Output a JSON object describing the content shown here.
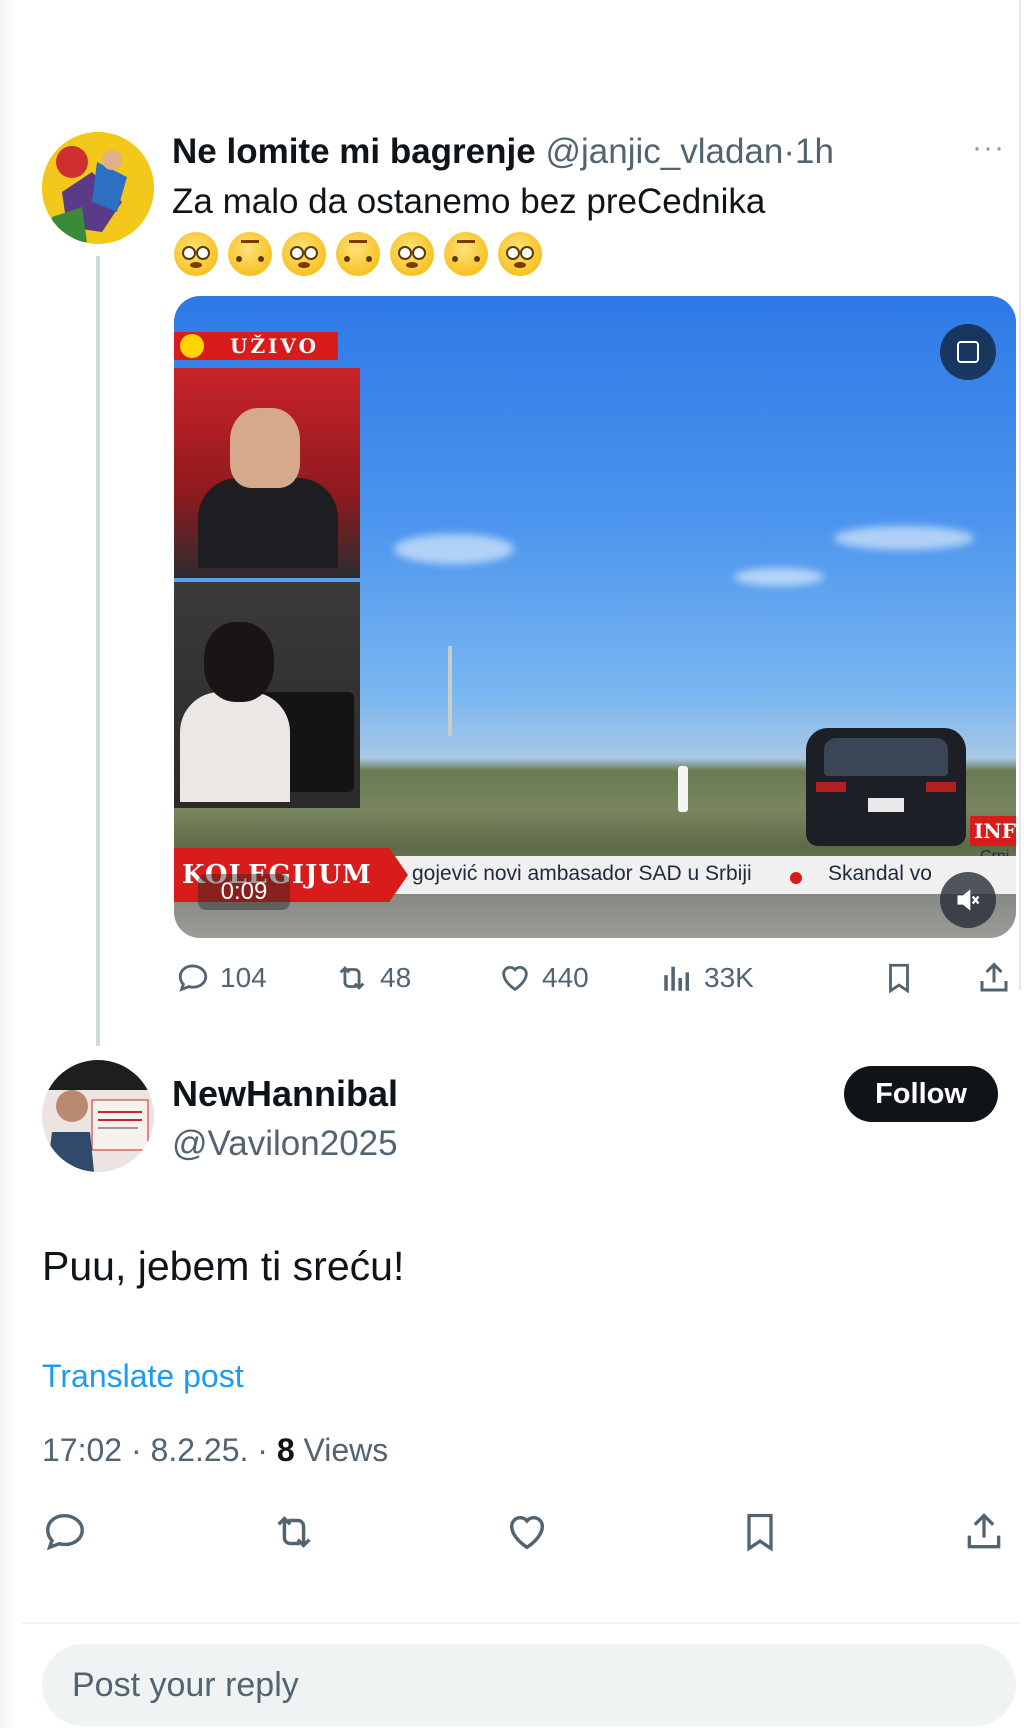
{
  "parent_post": {
    "display_name": "Ne lomite mi bagrenje",
    "handle": "@janjic_vladan",
    "separator": "·",
    "time": "1h",
    "text": "Za malo da ostanemo bez preCednika",
    "emojis": [
      "flushed-face",
      "upside-down-face",
      "flushed-face",
      "upside-down-face",
      "flushed-face",
      "upside-down-face",
      "flushed-face"
    ],
    "video": {
      "live_label": "UŽIVO",
      "ticker_logo": "KOLEGIJUM",
      "ticker_text": "gojević novi ambasador SAD u Srbiji",
      "ticker_text_2": "Skandal vo",
      "inf_badge": "INF",
      "inf_sub": "Crni",
      "elapsed": "0:09"
    },
    "stats": {
      "replies": "104",
      "reposts": "48",
      "likes": "440",
      "views": "33K"
    }
  },
  "reply_post": {
    "display_name": "NewHannibal",
    "handle": "@Vavilon2025",
    "follow_label": "Follow",
    "text": "Puu, jebem ti sreću!",
    "translate_label": "Translate post",
    "timestamp": "17:02 · 8.2.25. · ",
    "views_count": "8",
    "views_label": " Views"
  },
  "composer": {
    "placeholder": "Post your reply"
  },
  "colors": {
    "accent": "#1d9bf0",
    "text_primary": "#0f1419",
    "text_secondary": "#536471",
    "live_red": "#d81b1b"
  }
}
